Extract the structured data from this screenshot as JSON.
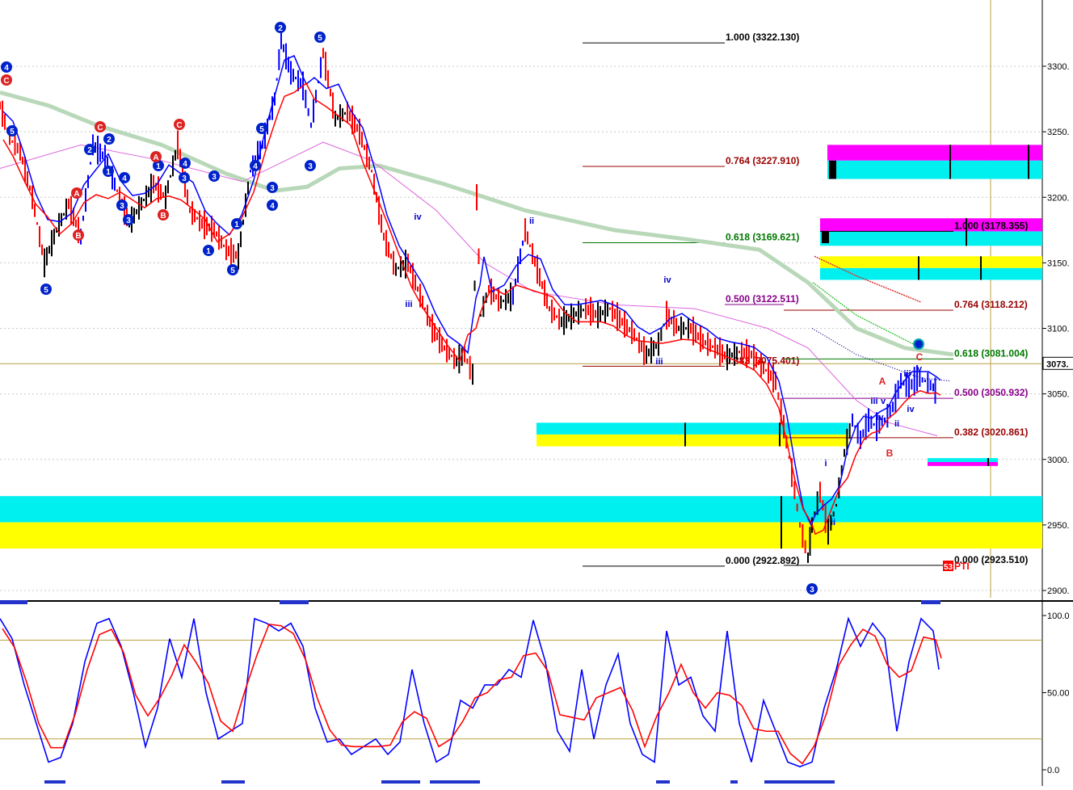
{
  "colors": {
    "price_up": "#000000",
    "price_down": "#ff0000",
    "price_wave": "#0000ff",
    "ma_fast": "#0000ff",
    "ma_slow": "#ff0000",
    "ma_long": "#b9d8b9",
    "ma_mid": "#dd66dd",
    "cyan": "#00f0f0",
    "yellow": "#ffff00",
    "magenta": "#ff00ff",
    "grid": "#c8c8c8",
    "olive_line": "#b8a040",
    "osc_fast": "#0000ff",
    "osc_slow": "#ff0000"
  },
  "chart_data": [
    {
      "type": "line",
      "panel": "price",
      "ylim": [
        2895,
        3345
      ],
      "x": [
        0,
        12,
        25,
        40,
        55,
        70,
        85,
        100,
        115,
        130,
        145,
        160,
        175,
        190,
        205,
        220,
        235,
        250,
        265,
        280,
        295,
        310,
        325,
        340,
        348,
        360,
        375,
        385,
        400,
        415,
        430,
        445,
        460,
        475,
        490,
        505,
        520,
        535,
        550,
        565,
        575,
        585,
        590,
        595,
        605,
        620,
        635,
        650,
        665,
        680,
        695,
        710,
        725,
        740,
        755,
        770,
        785,
        800,
        815,
        825,
        840,
        855,
        870,
        885,
        900,
        915,
        930,
        945,
        960,
        970,
        980,
        990,
        1000,
        1005,
        1015,
        1025,
        1035,
        1045,
        1055,
        1065,
        1075,
        1085,
        1095,
        1105,
        1115,
        1125,
        1135,
        1145,
        1155,
        1160
      ],
      "y": [
        3270,
        3245,
        3235,
        3200,
        3150,
        3175,
        3195,
        3170,
        3240,
        3230,
        3205,
        3180,
        3195,
        3210,
        3200,
        3240,
        3190,
        3180,
        3175,
        3160,
        3155,
        3220,
        3240,
        3275,
        3320,
        3295,
        3285,
        3255,
        3310,
        3260,
        3265,
        3250,
        3220,
        3170,
        3145,
        3150,
        3125,
        3100,
        3085,
        3075,
        3080,
        3065,
        3200,
        3110,
        3130,
        3120,
        3125,
        3175,
        3145,
        3115,
        3105,
        3110,
        3115,
        3110,
        3115,
        3105,
        3095,
        3080,
        3088,
        3110,
        3100,
        3100,
        3090,
        3085,
        3078,
        3082,
        3080,
        3070,
        3060,
        3025,
        2990,
        2950,
        2925,
        2950,
        2975,
        2945,
        2965,
        3005,
        3030,
        3015,
        3030,
        3025,
        3030,
        3040,
        3060,
        3055,
        3062,
        3060,
        3055,
        3050
      ]
    },
    {
      "type": "line",
      "panel": "oscillator",
      "ylim": [
        0,
        105
      ],
      "x": [
        0,
        15,
        30,
        45,
        60,
        75,
        90,
        105,
        120,
        135,
        150,
        165,
        180,
        195,
        210,
        225,
        240,
        255,
        270,
        285,
        300,
        315,
        330,
        345,
        360,
        375,
        390,
        405,
        420,
        435,
        450,
        465,
        480,
        495,
        510,
        525,
        540,
        555,
        570,
        585,
        600,
        615,
        630,
        645,
        660,
        675,
        690,
        705,
        720,
        735,
        750,
        765,
        780,
        795,
        810,
        825,
        840,
        855,
        870,
        885,
        900,
        915,
        930,
        945,
        960,
        975,
        990,
        1005,
        1020,
        1035,
        1050,
        1065,
        1080,
        1095,
        1110,
        1125,
        1140,
        1155,
        1162
      ],
      "y": [
        98,
        85,
        55,
        30,
        5,
        8,
        30,
        70,
        95,
        98,
        80,
        50,
        15,
        40,
        85,
        60,
        98,
        50,
        20,
        25,
        30,
        98,
        95,
        90,
        95,
        80,
        40,
        18,
        20,
        10,
        15,
        20,
        10,
        18,
        65,
        30,
        5,
        10,
        45,
        40,
        55,
        55,
        65,
        60,
        97,
        70,
        25,
        12,
        65,
        20,
        55,
        75,
        30,
        10,
        5,
        90,
        55,
        60,
        35,
        25,
        90,
        30,
        5,
        45,
        25,
        5,
        2,
        5,
        40,
        65,
        98,
        80,
        95,
        85,
        25,
        70,
        98,
        90,
        65,
        62
      ]
    }
  ],
  "fib_labels": [
    {
      "text": "1.000 (3322.130)",
      "value": 3322.13,
      "color": "#000000"
    },
    {
      "text": "0.764 (3227.910)",
      "value": 3227.91,
      "color": "#990000"
    },
    {
      "text": "0.618 (3169.621)",
      "value": 3169.621,
      "color": "#007700"
    },
    {
      "text": "0.500 (3122.511)",
      "value": 3122.511,
      "color": "#880088"
    },
    {
      "text": "0.382 (3075.401)",
      "value": 3075.401,
      "color": "#990000"
    },
    {
      "text": "0.000 (2922.892)",
      "value": 2922.892,
      "color": "#000000"
    },
    {
      "text": "1.000 (3178.355)",
      "value": 3178.355,
      "color": "#000000"
    },
    {
      "text": "0.764 (3118.212)",
      "value": 3118.212,
      "color": "#990000"
    },
    {
      "text": "0.618 (3081.004)",
      "value": 3081.004,
      "color": "#007700"
    },
    {
      "text": "0.500 (3050.932)",
      "value": 3050.932,
      "color": "#880088"
    },
    {
      "text": "0.382 (3020.861)",
      "value": 3020.861,
      "color": "#990000"
    },
    {
      "text": "0.000 (2923.510)",
      "value": 2923.51,
      "color": "#000000"
    }
  ],
  "price_axis": {
    "ticks": [
      "3300.",
      "3250.",
      "3200.",
      "3150.",
      "3100.",
      "3050.",
      "3000.",
      "2950.",
      "2900."
    ],
    "current": "3073."
  },
  "osc_axis": {
    "ticks": [
      "100.0",
      "50.00",
      "0.0"
    ]
  },
  "marker_text": "PTI",
  "marker_badge": "53",
  "wave_labels": {
    "circled_blue": [
      "4",
      "5",
      "2",
      "5",
      "3",
      "1",
      "2",
      "4",
      "3",
      "1",
      "5",
      "1",
      "3",
      "5",
      "4",
      "3",
      "3",
      "4",
      "1",
      "5",
      "2",
      "4",
      "3",
      "3"
    ],
    "circled_red": [
      "C",
      "A",
      "C",
      "B",
      "A",
      "B",
      "C"
    ],
    "roman_blue": [
      "ii",
      "iv",
      "iii",
      "iv",
      "iii",
      "i",
      "ii",
      "iii",
      "v",
      "iii",
      "iv",
      "v",
      "ii",
      "iv"
    ],
    "roman_red": [
      "A",
      "B",
      "C"
    ]
  }
}
